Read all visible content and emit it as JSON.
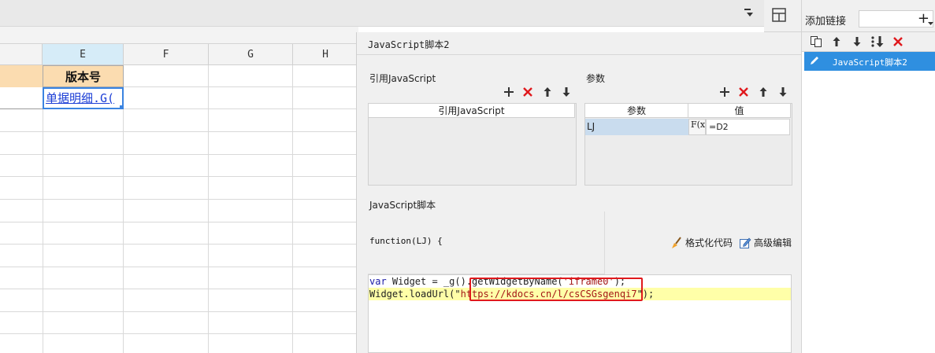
{
  "spreadsheet": {
    "columns": [
      "E",
      "F",
      "G",
      "H"
    ],
    "header_cell": "版本号",
    "link_cell": "单据明细.G("
  },
  "dialog": {
    "title": "JavaScript脚本2",
    "ref_section": {
      "title": "引用JavaScript",
      "column_header": "引用JavaScript"
    },
    "params_section": {
      "title": "参数",
      "columns": [
        "参数",
        "值"
      ],
      "rows": [
        {
          "name": "LJ",
          "fx": "F(x)",
          "value": "=D2"
        }
      ]
    },
    "script_section": {
      "title": "JavaScript脚本",
      "function_signature": "function(LJ) {",
      "format_code_label": "格式化代码",
      "advanced_edit_label": "高级编辑",
      "code_line1": {
        "kw": "var",
        "text1": " Widget = _g(",
        "text2": ").getWidgetByName(",
        "str": "'iframe0'",
        "text3": ");"
      },
      "code_line2": {
        "text1": "Widget.loadUrl(\"",
        "url": "https://kdocs.cn/l/csCSGsgenqi7",
        "text2": "\");"
      }
    }
  },
  "right_panel": {
    "add_link_label": "添加链接",
    "add_icon": "+",
    "items": [
      "JavaScript脚本2"
    ]
  },
  "colors": {
    "accent_blue": "#2f8fe0",
    "highlight_red": "#e0191d",
    "header_orange": "#fbdcb0",
    "delete_red": "#e0191d"
  }
}
